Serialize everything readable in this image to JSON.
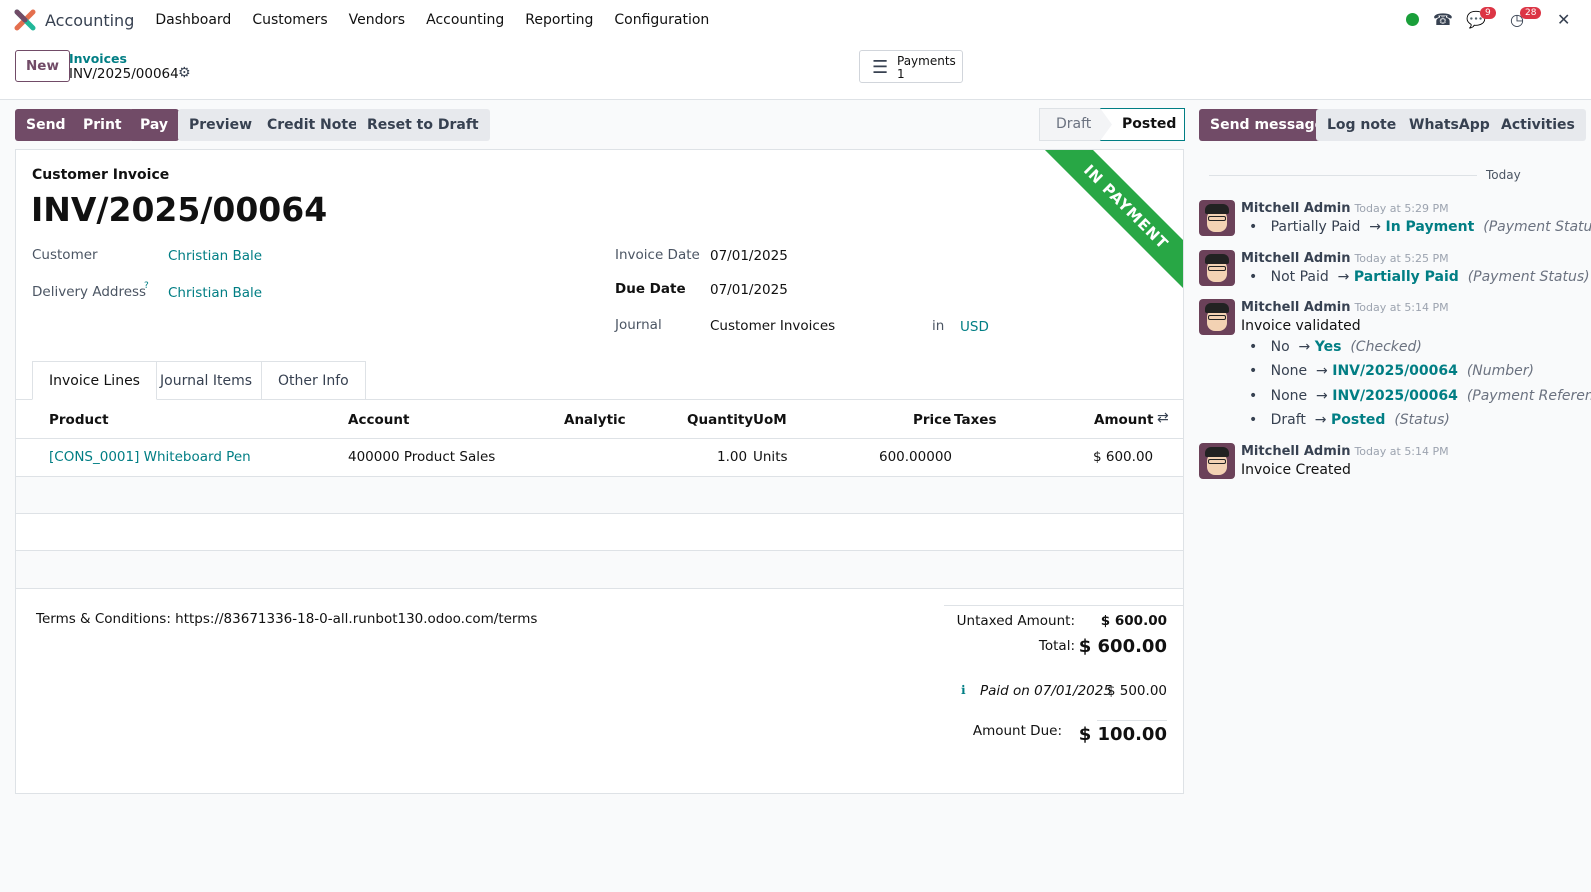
{
  "nav": {
    "app": "Accounting",
    "menus": [
      "Dashboard",
      "Customers",
      "Vendors",
      "Accounting",
      "Reporting",
      "Configuration"
    ],
    "messages_count": "9",
    "activities_count": "28"
  },
  "control": {
    "new": "New",
    "breadcrumb": "Invoices",
    "record": "INV/2025/00064",
    "payments_label": "Payments",
    "payments_count": "1"
  },
  "actions": {
    "send": "Send",
    "print": "Print",
    "pay": "Pay",
    "preview": "Preview",
    "credit_note": "Credit Note",
    "reset": "Reset to Draft"
  },
  "status": {
    "draft": "Draft",
    "posted": "Posted",
    "current": "Posted"
  },
  "chatter_buttons": {
    "send_message": "Send message",
    "log_note": "Log note",
    "whatsapp": "WhatsApp",
    "activities": "Activities"
  },
  "form": {
    "type": "Customer Invoice",
    "name": "INV/2025/00064",
    "ribbon": "IN PAYMENT",
    "ribbon_color": "#28a745",
    "customer_label": "Customer",
    "customer": "Christian Bale",
    "delivery_label": "Delivery Address",
    "delivery_help": "?",
    "delivery": "Christian Bale",
    "invoice_date_label": "Invoice Date",
    "invoice_date": "07/01/2025",
    "due_date_label": "Due Date",
    "due_date": "07/01/2025",
    "journal_label": "Journal",
    "journal": "Customer Invoices",
    "in": "in",
    "currency": "USD"
  },
  "tabs": [
    "Invoice Lines",
    "Journal Items",
    "Other Info"
  ],
  "table": {
    "headers": [
      "Product",
      "Account",
      "Analytic",
      "Quantity",
      "UoM",
      "Price",
      "Taxes",
      "Amount"
    ],
    "rows": [
      {
        "product": "[CONS_0001] Whiteboard Pen",
        "account": "400000 Product Sales",
        "analytic": "",
        "quantity": "1.00",
        "uom": "Units",
        "price": "600.00000",
        "taxes": "",
        "amount": "$ 600.00"
      }
    ]
  },
  "terms": "Terms & Conditions: https://83671336-18-0-all.runbot130.odoo.com/terms",
  "totals": {
    "untaxed_label": "Untaxed Amount:",
    "untaxed": "$ 600.00",
    "total_label": "Total:",
    "total": "$ 600.00",
    "paid_label": "Paid on 07/01/2025",
    "paid": "$ 500.00",
    "due_label": "Amount Due:",
    "due": "$ 100.00"
  },
  "chatter": {
    "date_sep": "Today",
    "messages": [
      {
        "author": "Mitchell Admin",
        "time": "Today at 5:29 PM",
        "changes": [
          {
            "old": "Partially Paid",
            "new": "In Payment",
            "field": "(Payment Status)"
          }
        ]
      },
      {
        "author": "Mitchell Admin",
        "time": "Today at 5:25 PM",
        "changes": [
          {
            "old": "Not Paid",
            "new": "Partially Paid",
            "field": "(Payment Status)"
          }
        ]
      },
      {
        "author": "Mitchell Admin",
        "time": "Today at 5:14 PM",
        "body": "Invoice validated",
        "changes": [
          {
            "old": "No",
            "new": "Yes",
            "field": "(Checked)"
          },
          {
            "old": "None",
            "new": "INV/2025/00064",
            "field": "(Number)"
          },
          {
            "old": "None",
            "new": "INV/2025/00064",
            "field": "(Payment Reference)"
          },
          {
            "old": "Draft",
            "new": "Posted",
            "field": "(Status)"
          }
        ]
      },
      {
        "author": "Mitchell Admin",
        "time": "Today at 5:14 PM",
        "body": "Invoice Created"
      }
    ]
  }
}
